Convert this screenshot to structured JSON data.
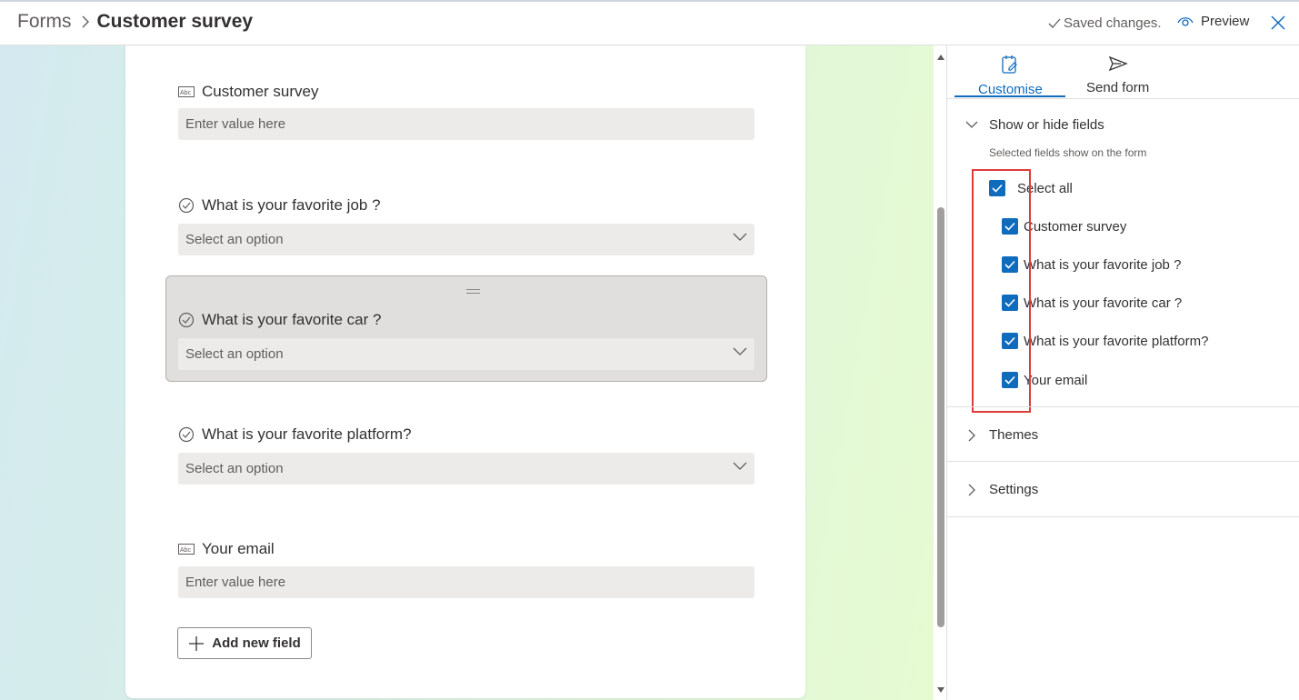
{
  "header": {
    "breadcrumb_root": "Forms",
    "breadcrumb_current": "Customer survey",
    "saved_status": "Saved changes.",
    "preview_label": "Preview"
  },
  "form": {
    "fields": [
      {
        "label": "Customer survey",
        "type": "text",
        "placeholder": "Enter value here",
        "icon": "text-field-icon"
      },
      {
        "label": "What is your favorite job ?",
        "type": "choice",
        "placeholder": "Select an option",
        "icon": "choice-field-icon"
      },
      {
        "label": "What is your favorite car ?",
        "type": "choice",
        "placeholder": "Select an option",
        "icon": "choice-field-icon"
      },
      {
        "label": "What is your favorite platform?",
        "type": "choice",
        "placeholder": "Select an option",
        "icon": "choice-field-icon"
      },
      {
        "label": "Your email",
        "type": "text",
        "placeholder": "Enter value here",
        "icon": "text-field-icon"
      }
    ],
    "add_field_label": "Add new field"
  },
  "pane": {
    "tabs": [
      {
        "label": "Customise",
        "icon": "customise-icon",
        "active": true
      },
      {
        "label": "Send form",
        "icon": "send-icon",
        "active": false
      }
    ],
    "show_hide": {
      "title": "Show or hide fields",
      "description": "Selected fields show on the form",
      "select_all": "Select all",
      "items": [
        "Customer survey",
        "What is your favorite job ?",
        "What is your favorite car ?",
        "What is your favorite platform?",
        "Your email"
      ]
    },
    "themes_label": "Themes",
    "settings_label": "Settings"
  },
  "colors": {
    "accent": "#0f6cbd",
    "highlight": "#e03b3b"
  }
}
